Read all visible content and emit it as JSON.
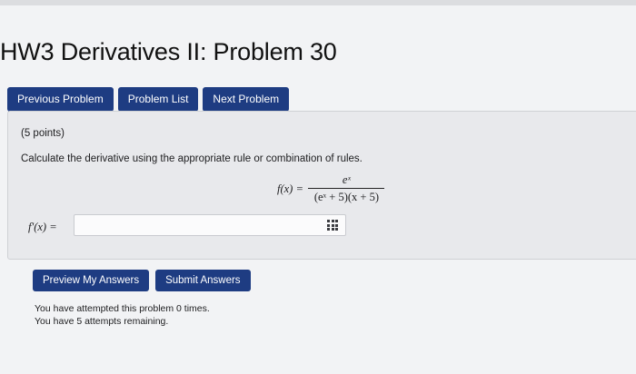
{
  "header": {
    "title": "HW3 Derivatives II: Problem 30"
  },
  "nav": {
    "previous_label": "Previous Problem",
    "list_label": "Problem List",
    "next_label": "Next Problem"
  },
  "problem": {
    "points": "(5 points)",
    "instructions": "Calculate the derivative using the appropriate rule or combination of rules.",
    "formula": {
      "lhs": "f(x)",
      "equals": "=",
      "numerator": "eˣ",
      "denominator": "(eˣ + 5)(x + 5)"
    },
    "answer": {
      "label": "f′(x) =",
      "value": "",
      "editor_icon": "grid-icon"
    }
  },
  "actions": {
    "preview_label": "Preview My Answers",
    "submit_label": "Submit Answers"
  },
  "status": {
    "attempted": "You have attempted this problem 0 times.",
    "remaining": "You have 5 attempts remaining."
  },
  "colors": {
    "button": "#1e3c82",
    "panel": "#e8e9ec",
    "background": "#f2f3f5"
  }
}
